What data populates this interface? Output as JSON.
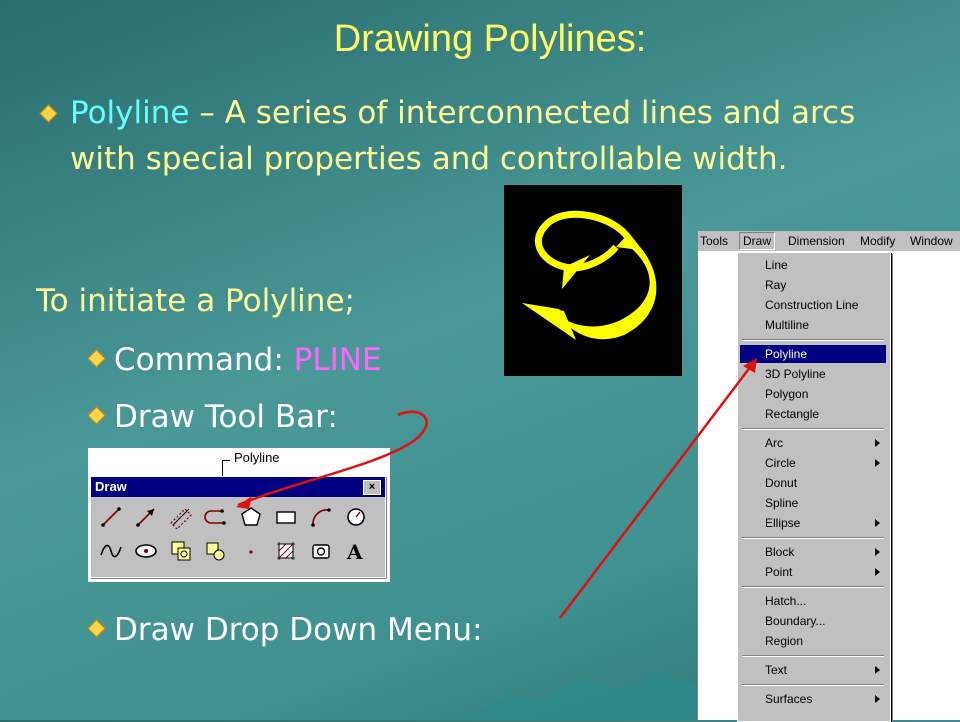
{
  "title": "Drawing Polylines:",
  "bullet": {
    "term": "Polyline",
    "definition": " – A series of interconnected lines and arcs with special properties and controllable width."
  },
  "initiate_label": "To initiate a Polyline;",
  "methods": [
    {
      "label": "Command: ",
      "value": "PLINE"
    },
    {
      "label": "Draw Tool Bar:"
    },
    {
      "label": "Draw Drop Down Menu:"
    }
  ],
  "toolbar": {
    "callout": "Polyline",
    "title": "Draw",
    "close": "×",
    "row1_icons": [
      "line-icon",
      "ray-icon",
      "construction-line-icon",
      "polyline-icon",
      "polygon-icon",
      "rectangle-icon",
      "arc-icon",
      "circle-icon"
    ],
    "row2_icons": [
      "spline-icon",
      "ellipse-icon",
      "insert-block-icon",
      "make-block-icon",
      "point-icon",
      "hatch-icon",
      "region-icon",
      "multiline-text-icon"
    ],
    "text_tool_label": "A"
  },
  "menubar": [
    "Tools",
    "Draw",
    "Dimension",
    "Modify",
    "Window"
  ],
  "menu_items": [
    {
      "label": "Line"
    },
    {
      "label": "Ray"
    },
    {
      "label": "Construction Line"
    },
    {
      "label": "Multiline"
    },
    {
      "separator": true
    },
    {
      "label": "Polyline",
      "selected": true
    },
    {
      "label": "3D Polyline"
    },
    {
      "label": "Polygon"
    },
    {
      "label": "Rectangle"
    },
    {
      "separator": true
    },
    {
      "label": "Arc",
      "submenu": true
    },
    {
      "label": "Circle",
      "submenu": true
    },
    {
      "label": "Donut"
    },
    {
      "label": "Spline"
    },
    {
      "label": "Ellipse",
      "submenu": true
    },
    {
      "separator": true
    },
    {
      "label": "Block",
      "submenu": true
    },
    {
      "label": "Point",
      "submenu": true
    },
    {
      "separator": true
    },
    {
      "label": "Hatch..."
    },
    {
      "label": "Boundary..."
    },
    {
      "label": "Region"
    },
    {
      "separator": true
    },
    {
      "label": "Text",
      "submenu": true
    },
    {
      "separator": true
    },
    {
      "label": "Surfaces",
      "submenu": true
    }
  ],
  "colors": {
    "title": "#ffff66",
    "bullet_text": "#ffff99",
    "keyword": "#66ffff",
    "command": "#ff66ff",
    "menu_highlight": "#000080",
    "annotation_arrow": "#e01010",
    "polyline_stroke": "#ffff00"
  }
}
